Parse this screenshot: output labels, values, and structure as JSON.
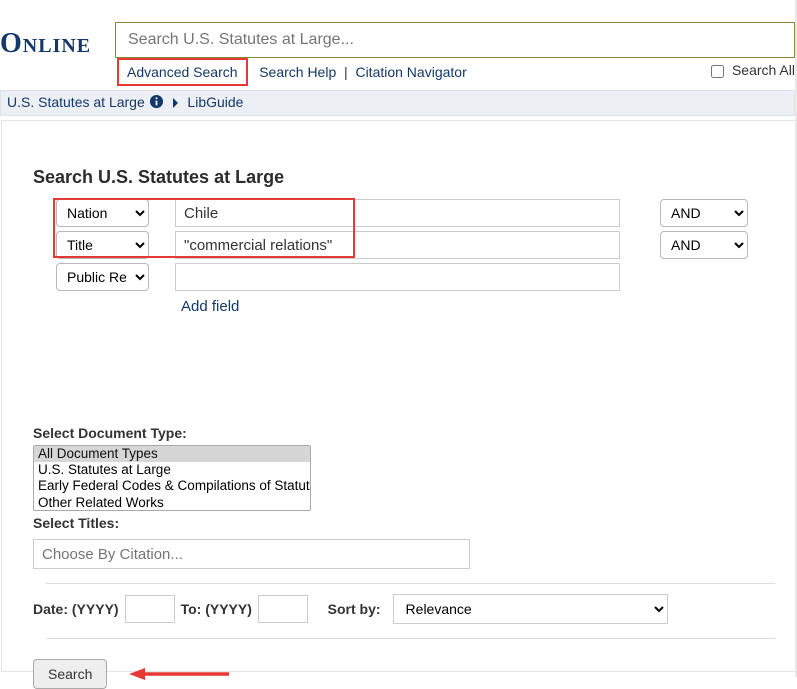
{
  "header": {
    "logo": "Online",
    "search_placeholder": "Search U.S. Statutes at Large...",
    "adv_search": "Advanced Search",
    "search_help": "Search Help",
    "citation_nav": "Citation Navigator",
    "search_all": "Search All"
  },
  "breadcrumb": {
    "library": "U.S. Statutes at Large",
    "libguide": "LibGuide"
  },
  "search": {
    "heading": "Search U.S. Statutes at Large",
    "rows": [
      {
        "field": "Nation",
        "value": "Chile",
        "op": "AND"
      },
      {
        "field": "Title",
        "value": "\"commercial relations\"",
        "op": "AND"
      },
      {
        "field": "Public Re",
        "value": ""
      }
    ],
    "add_field": "Add field"
  },
  "doc_types": {
    "label": "Select Document Type:",
    "options": [
      "All Document Types",
      "U.S. Statutes at Large",
      "Early Federal Codes & Compilations of Statutes",
      "Other Related Works"
    ]
  },
  "titles": {
    "label": "Select Titles:",
    "placeholder": "Choose By Citation..."
  },
  "date": {
    "from_label": "Date: (YYYY)",
    "to_label": "To: (YYYY)",
    "sort_label": "Sort by:",
    "sort_value": "Relevance"
  },
  "buttons": {
    "search": "Search"
  }
}
